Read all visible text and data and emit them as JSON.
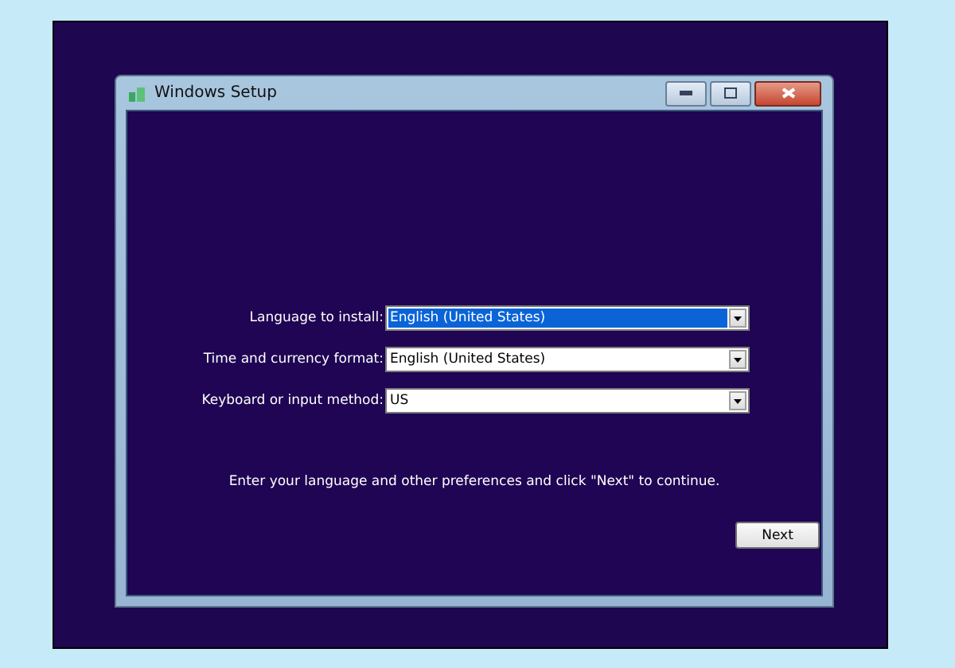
{
  "window": {
    "title": "Windows Setup"
  },
  "fields": [
    {
      "label": "Language to install:",
      "value": "English (United States)",
      "selected": true
    },
    {
      "label": "Time and currency format:",
      "value": "English (United States)",
      "selected": false
    },
    {
      "label": "Keyboard or input method:",
      "value": "US",
      "selected": false
    }
  ],
  "message": "Enter your language and other preferences and click \"Next\" to continue.",
  "buttons": [
    "Next"
  ]
}
